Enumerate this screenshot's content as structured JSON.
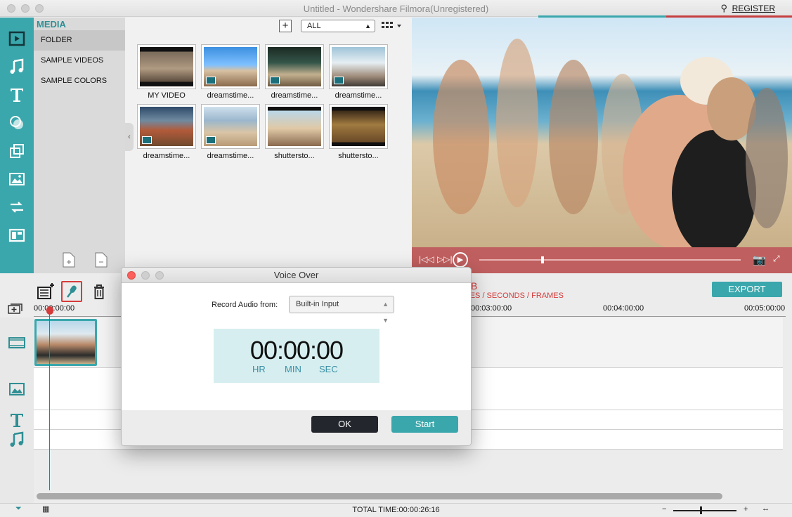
{
  "window": {
    "title": "Untitled - Wondershare Filmora(Unregistered)",
    "register": "REGISTER"
  },
  "media": {
    "header": "MEDIA",
    "categories": [
      "FOLDER",
      "SAMPLE VIDEOS",
      "SAMPLE COLORS"
    ],
    "filter_value": "ALL",
    "items": [
      {
        "label": "MY VIDEO"
      },
      {
        "label": "dreamstime..."
      },
      {
        "label": "dreamstime..."
      },
      {
        "label": "dreamstime..."
      },
      {
        "label": "dreamstime..."
      },
      {
        "label": "dreamstime..."
      },
      {
        "label": "shuttersto..."
      },
      {
        "label": "shuttersto..."
      }
    ]
  },
  "timeline": {
    "export_label": "EXPORT",
    "timecode_units": "TES / SECONDS / FRAMES",
    "ruler": [
      "00:00:00:00",
      "00:03:00:00",
      "00:04:00:00",
      "00:05:00:00"
    ],
    "total_time": "TOTAL TIME:00:00:26:16"
  },
  "dialog": {
    "title": "Voice Over",
    "record_label": "Record Audio from:",
    "input_value": "Built-in Input",
    "timer": "00:00:00",
    "units": [
      "HR",
      "MIN",
      "SEC"
    ],
    "ok": "OK",
    "start": "Start"
  },
  "colors": {
    "accent": "#3aa7ac",
    "highlight": "#d63b3b",
    "preview_controls": "#c05f5f"
  }
}
